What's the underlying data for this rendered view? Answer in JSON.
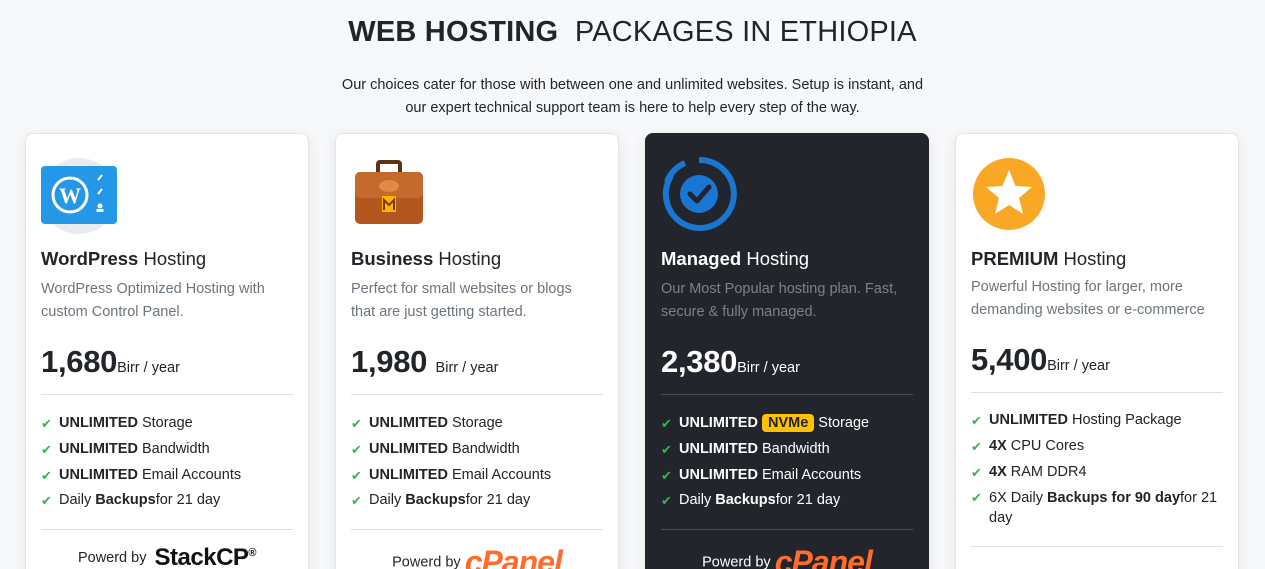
{
  "header": {
    "title_bold": "WEB HOSTING",
    "title_light": "PACKAGES IN ETHIOPIA",
    "subtitle_line1": "Our choices cater for those with between one and unlimited websites. Setup is instant, and",
    "subtitle_line2": "our expert technical support team is here to help every step of the way."
  },
  "colors": {
    "accent": "#39b54a",
    "dark_card": "#22252b",
    "badge": "#ffc107",
    "cpanel": "#ff6c2c"
  },
  "plans": [
    {
      "icon": "wordpress-icon",
      "name_bold": "WordPress",
      "name_rest": " Hosting",
      "desc": "WordPress Optimized Hosting with custom Control Panel.",
      "price": "1,680",
      "price_unit": "Birr / year",
      "features": [
        {
          "bold": "UNLIMITED",
          "text": " Storage"
        },
        {
          "bold": "UNLIMITED",
          "text": " Bandwidth"
        },
        {
          "bold": "UNLIMITED",
          "text": " Email Accounts"
        },
        {
          "pre": "Daily ",
          "bold": "Backups",
          "text": "for 21 day"
        }
      ],
      "powered_label": "Powerd by",
      "powered_logo": "StackCP",
      "powered_mark": "®"
    },
    {
      "icon": "briefcase-icon",
      "name_bold": "Business",
      "name_rest": " Hosting",
      "desc": "Perfect for small websites or blogs that are just getting started.",
      "price": "1,980",
      "price_unit": " Birr / year",
      "features": [
        {
          "bold": "UNLIMITED",
          "text": " Storage"
        },
        {
          "bold": "UNLIMITED",
          "text": " Bandwidth"
        },
        {
          "bold": "UNLIMITED",
          "text": " Email Accounts"
        },
        {
          "pre": "Daily ",
          "bold": "Backups",
          "text": "for 21 day"
        }
      ],
      "powered_label": "Powerd by",
      "powered_logo": "cPanel"
    },
    {
      "icon": "managed-check-icon",
      "name_bold": "Managed",
      "name_rest": " Hosting",
      "desc": "Our Most Popular hosting plan. Fast, secure & fully managed.",
      "price": "2,380",
      "price_unit": "Birr / year",
      "features": [
        {
          "bold": "UNLIMITED",
          "badge": "NVMe",
          "text": "Storage"
        },
        {
          "bold": "UNLIMITED",
          "text": " Bandwidth"
        },
        {
          "bold": "UNLIMITED",
          "text": " Email Accounts"
        },
        {
          "pre": "Daily ",
          "bold": "Backups",
          "text": "for 21 day"
        }
      ],
      "powered_label": "Powerd by",
      "powered_logo": "cPanel"
    },
    {
      "icon": "star-icon",
      "name_bold": "PREMIUM",
      "name_rest": " Hosting",
      "desc": "Powerful Hosting for larger, more demanding websites or e-commerce",
      "price": "5,400",
      "price_unit": "Birr / year",
      "features": [
        {
          "bold": "UNLIMITED",
          "text": " Hosting Package"
        },
        {
          "bold": "4X",
          "text": " CPU Cores"
        },
        {
          "bold": "4X",
          "text": " RAM DDR4"
        },
        {
          "pre": "6X Daily ",
          "bold": "Backups for 90 day",
          "text": "for 21 day"
        }
      ]
    }
  ]
}
